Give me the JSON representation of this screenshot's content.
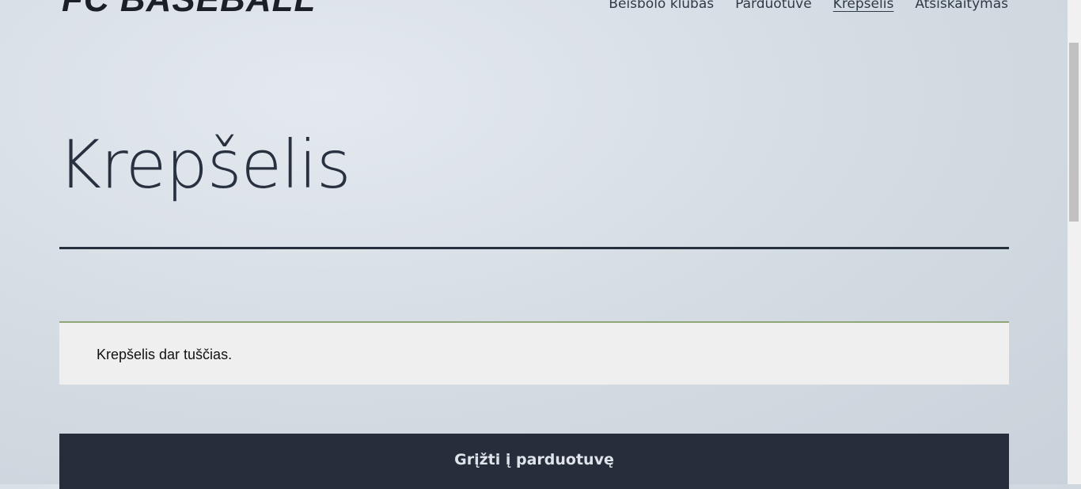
{
  "header": {
    "logo": "FC BASEBALL",
    "nav": [
      {
        "label": "Beisbolo klubas"
      },
      {
        "label": "Parduotuvė"
      },
      {
        "label": "Krepšelis"
      },
      {
        "label": "Atsiskaitymas"
      }
    ]
  },
  "page": {
    "title": "Krepšelis",
    "empty_notice": "Krepšelis dar tuščias.",
    "return_button": "Grįžti į parduotuvę"
  }
}
